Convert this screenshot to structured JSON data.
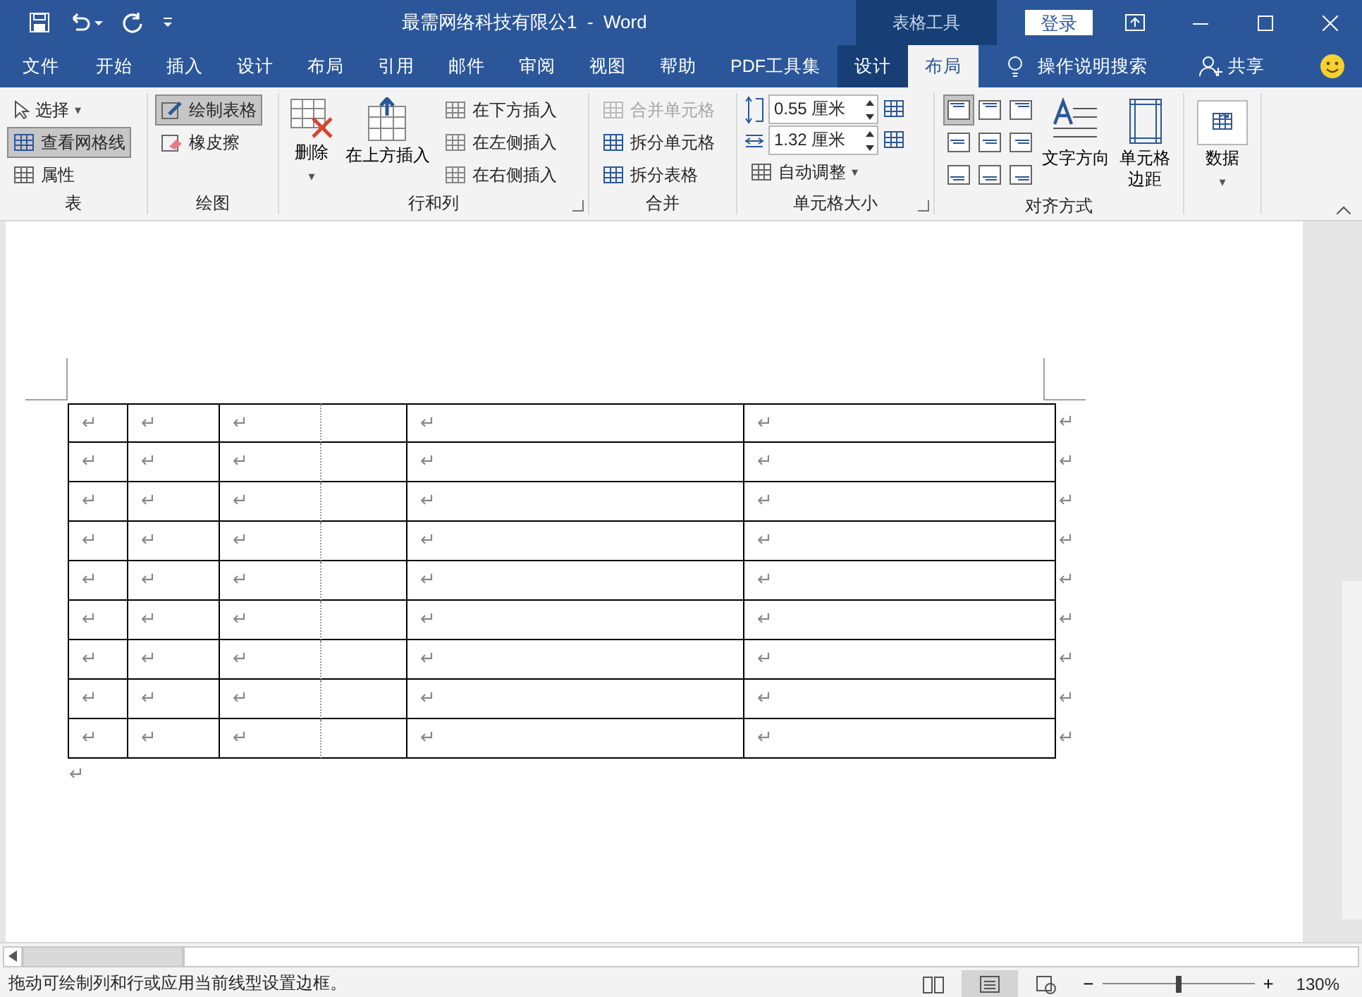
{
  "title_bar": {
    "title": "最需网络科技有限公1  -  Word",
    "context_header": "表格工具",
    "login": "登录"
  },
  "tabs": [
    {
      "label": "文件",
      "selected": false,
      "context": false
    },
    {
      "label": "开始",
      "selected": false,
      "context": false
    },
    {
      "label": "插入",
      "selected": false,
      "context": false
    },
    {
      "label": "设计",
      "selected": false,
      "context": false
    },
    {
      "label": "布局",
      "selected": false,
      "context": false
    },
    {
      "label": "引用",
      "selected": false,
      "context": false
    },
    {
      "label": "邮件",
      "selected": false,
      "context": false
    },
    {
      "label": "审阅",
      "selected": false,
      "context": false
    },
    {
      "label": "视图",
      "selected": false,
      "context": false
    },
    {
      "label": "帮助",
      "selected": false,
      "context": false
    },
    {
      "label": "PDF工具集",
      "selected": false,
      "context": false
    },
    {
      "label": "设计",
      "selected": false,
      "context": true
    },
    {
      "label": "布局",
      "selected": true,
      "context": true
    }
  ],
  "tell_me": "操作说明搜索",
  "share": "共享",
  "ribbon": {
    "table_group": {
      "label": "表",
      "items": [
        {
          "label": "选择",
          "on": false,
          "dropdown": "▾"
        },
        {
          "label": "查看网格线",
          "on": true
        },
        {
          "label": "属性",
          "on": false
        }
      ]
    },
    "draw_group": {
      "label": "绘图",
      "items": [
        {
          "label": "绘制表格",
          "on": true
        },
        {
          "label": "橡皮擦",
          "on": false
        }
      ]
    },
    "rows_group": {
      "label": "行和列",
      "delete": "删除",
      "delete_dropdown": "▾",
      "insert_above": "在上方插入",
      "small": [
        {
          "label": "在下方插入"
        },
        {
          "label": "在左侧插入"
        },
        {
          "label": "在右侧插入"
        }
      ]
    },
    "merge_group": {
      "label": "合并",
      "items": [
        {
          "label": "合并单元格",
          "disabled": true
        },
        {
          "label": "拆分单元格",
          "disabled": false
        },
        {
          "label": "拆分表格",
          "disabled": false
        }
      ]
    },
    "size_group": {
      "label": "单元格大小",
      "height": "0.55 厘米",
      "width": "1.32 厘米",
      "autofit": "自动调整",
      "autofit_dropdown": "▾"
    },
    "align_group": {
      "label": "对齐方式",
      "alignments": [
        {
          "selected": true
        },
        {
          "selected": false
        },
        {
          "selected": false
        },
        {
          "selected": false
        },
        {
          "selected": false
        },
        {
          "selected": false
        },
        {
          "selected": false
        },
        {
          "selected": false
        },
        {
          "selected": false
        }
      ],
      "text_direction": "文字方向",
      "margins": "单元格边距"
    },
    "data_group": {
      "label": "数据",
      "dropdown": "▾"
    }
  },
  "table": {
    "rows": [
      {
        "cells": [
          "↵",
          "↵",
          "↵",
          null,
          "↵",
          "↵"
        ],
        "end": "↵"
      },
      {
        "cells": [
          "↵",
          "↵",
          "↵",
          null,
          "↵",
          "↵"
        ],
        "end": "↵"
      },
      {
        "cells": [
          "↵",
          "↵",
          "↵",
          null,
          "↵",
          "↵"
        ],
        "end": "↵"
      },
      {
        "cells": [
          "↵",
          "↵",
          "↵",
          null,
          "↵",
          "↵"
        ],
        "end": "↵"
      },
      {
        "cells": [
          "↵",
          "↵",
          "↵",
          null,
          "↵",
          "↵"
        ],
        "end": "↵"
      },
      {
        "cells": [
          "↵",
          "↵",
          "↵",
          null,
          "↵",
          "↵"
        ],
        "end": "↵"
      },
      {
        "cells": [
          "↵",
          "↵",
          "↵",
          null,
          "↵",
          "↵"
        ],
        "end": "↵"
      },
      {
        "cells": [
          "↵",
          "↵",
          "↵",
          null,
          "↵",
          "↵"
        ],
        "end": "↵"
      },
      {
        "cells": [
          "↵",
          "↵",
          "↵",
          null,
          "↵",
          "↵"
        ],
        "end": "↵"
      }
    ],
    "after_mark": "↵"
  },
  "status_bar": {
    "message": "拖动可绘制列和行或应用当前线型设置边框。",
    "views": [
      {
        "kind": "read",
        "selected": false
      },
      {
        "kind": "print",
        "selected": true
      },
      {
        "kind": "web",
        "selected": false
      }
    ],
    "zoom_out": "−",
    "zoom_in": "+",
    "zoom": {
      "level": 0.5
    },
    "zoom_text": "130%"
  }
}
